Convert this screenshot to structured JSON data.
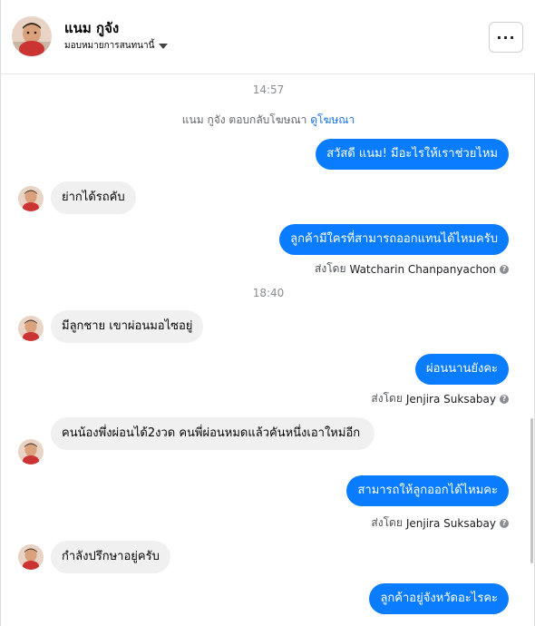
{
  "header": {
    "contact_name": "แนม กูจัง",
    "assign_label": "มอบหมายการสนทนานี้",
    "more_label": "···"
  },
  "chat": {
    "time_1": "14:57",
    "system_text": "แนม กูจัง ตอบกลับโฆษณา",
    "system_link": "ดูโฆษณา",
    "msg_out_1": "สวัสดี แนม! มีอะไรให้เราช่วยไหม",
    "msg_in_1": "ย่ากได้รถคับ",
    "msg_out_2": "ลูกค้ามีใครที่สามารถออกแทนได้ไหมครับ",
    "sent_by_prefix": "ส่งโดย",
    "sender_1": "Watcharin Chanpanyachon",
    "time_2": "18:40",
    "msg_in_2": "มีลูกชาย เขาผ่อนมอไซอยู่",
    "msg_out_3": "ผ่อนนานยังคะ",
    "sender_2": "Jenjira Suksabay",
    "msg_in_3": "คนน้องพึ่งผ่อนได้2งวด  คนพี่ผ่อนหมดแล้วคันหนึ่งเอาใหม่อีก",
    "msg_out_4": "สามารถให้ลูกออกได้ไหมคะ",
    "sender_3": "Jenjira Suksabay",
    "msg_in_4": "กำลังปรึกษาอยู่ครับ",
    "msg_out_5": "ลูกค้าอยู่จังหวัดอะไรคะ"
  }
}
